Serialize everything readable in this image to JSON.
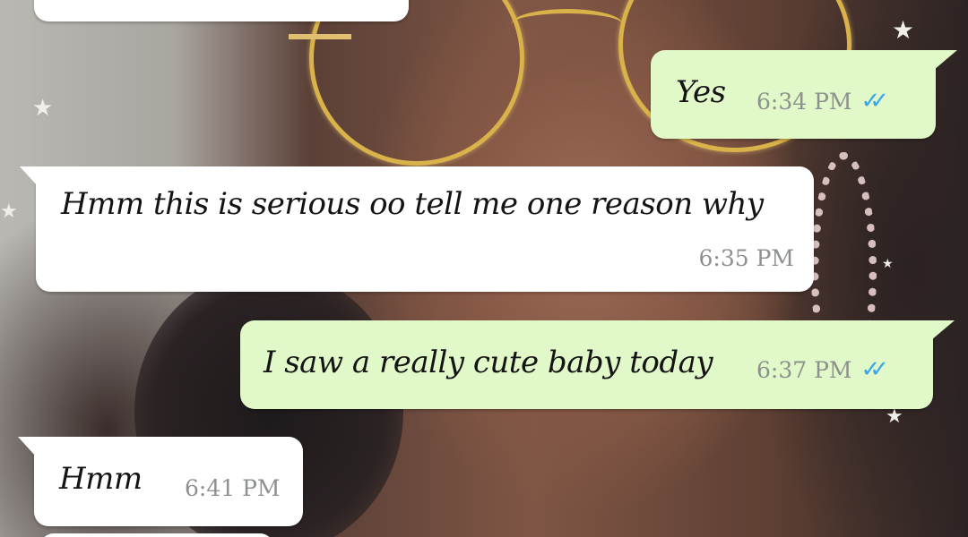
{
  "chat": {
    "messages": [
      {
        "direction": "outgoing",
        "text": "Yes",
        "time": "6:34 PM",
        "status_icon": "double-check-read-icon",
        "status_glyph": "✓✓"
      },
      {
        "direction": "incoming",
        "text": "Hmm this is serious oo tell me one reason why",
        "time": "6:35 PM"
      },
      {
        "direction": "outgoing",
        "text": "I saw a really cute baby today",
        "time": "6:37 PM",
        "status_icon": "double-check-read-icon",
        "status_glyph": "✓✓"
      },
      {
        "direction": "incoming",
        "text": "Hmm",
        "time": "6:41 PM"
      }
    ]
  },
  "colors": {
    "incoming_bubble": "#ffffff",
    "outgoing_bubble": "#e1f8c9",
    "timestamp": "#8d918e",
    "read_ticks": "#39a6ea"
  },
  "wallpaper": {
    "star_glyph": "★",
    "icon": "selfie-photo-wallpaper-icon"
  }
}
